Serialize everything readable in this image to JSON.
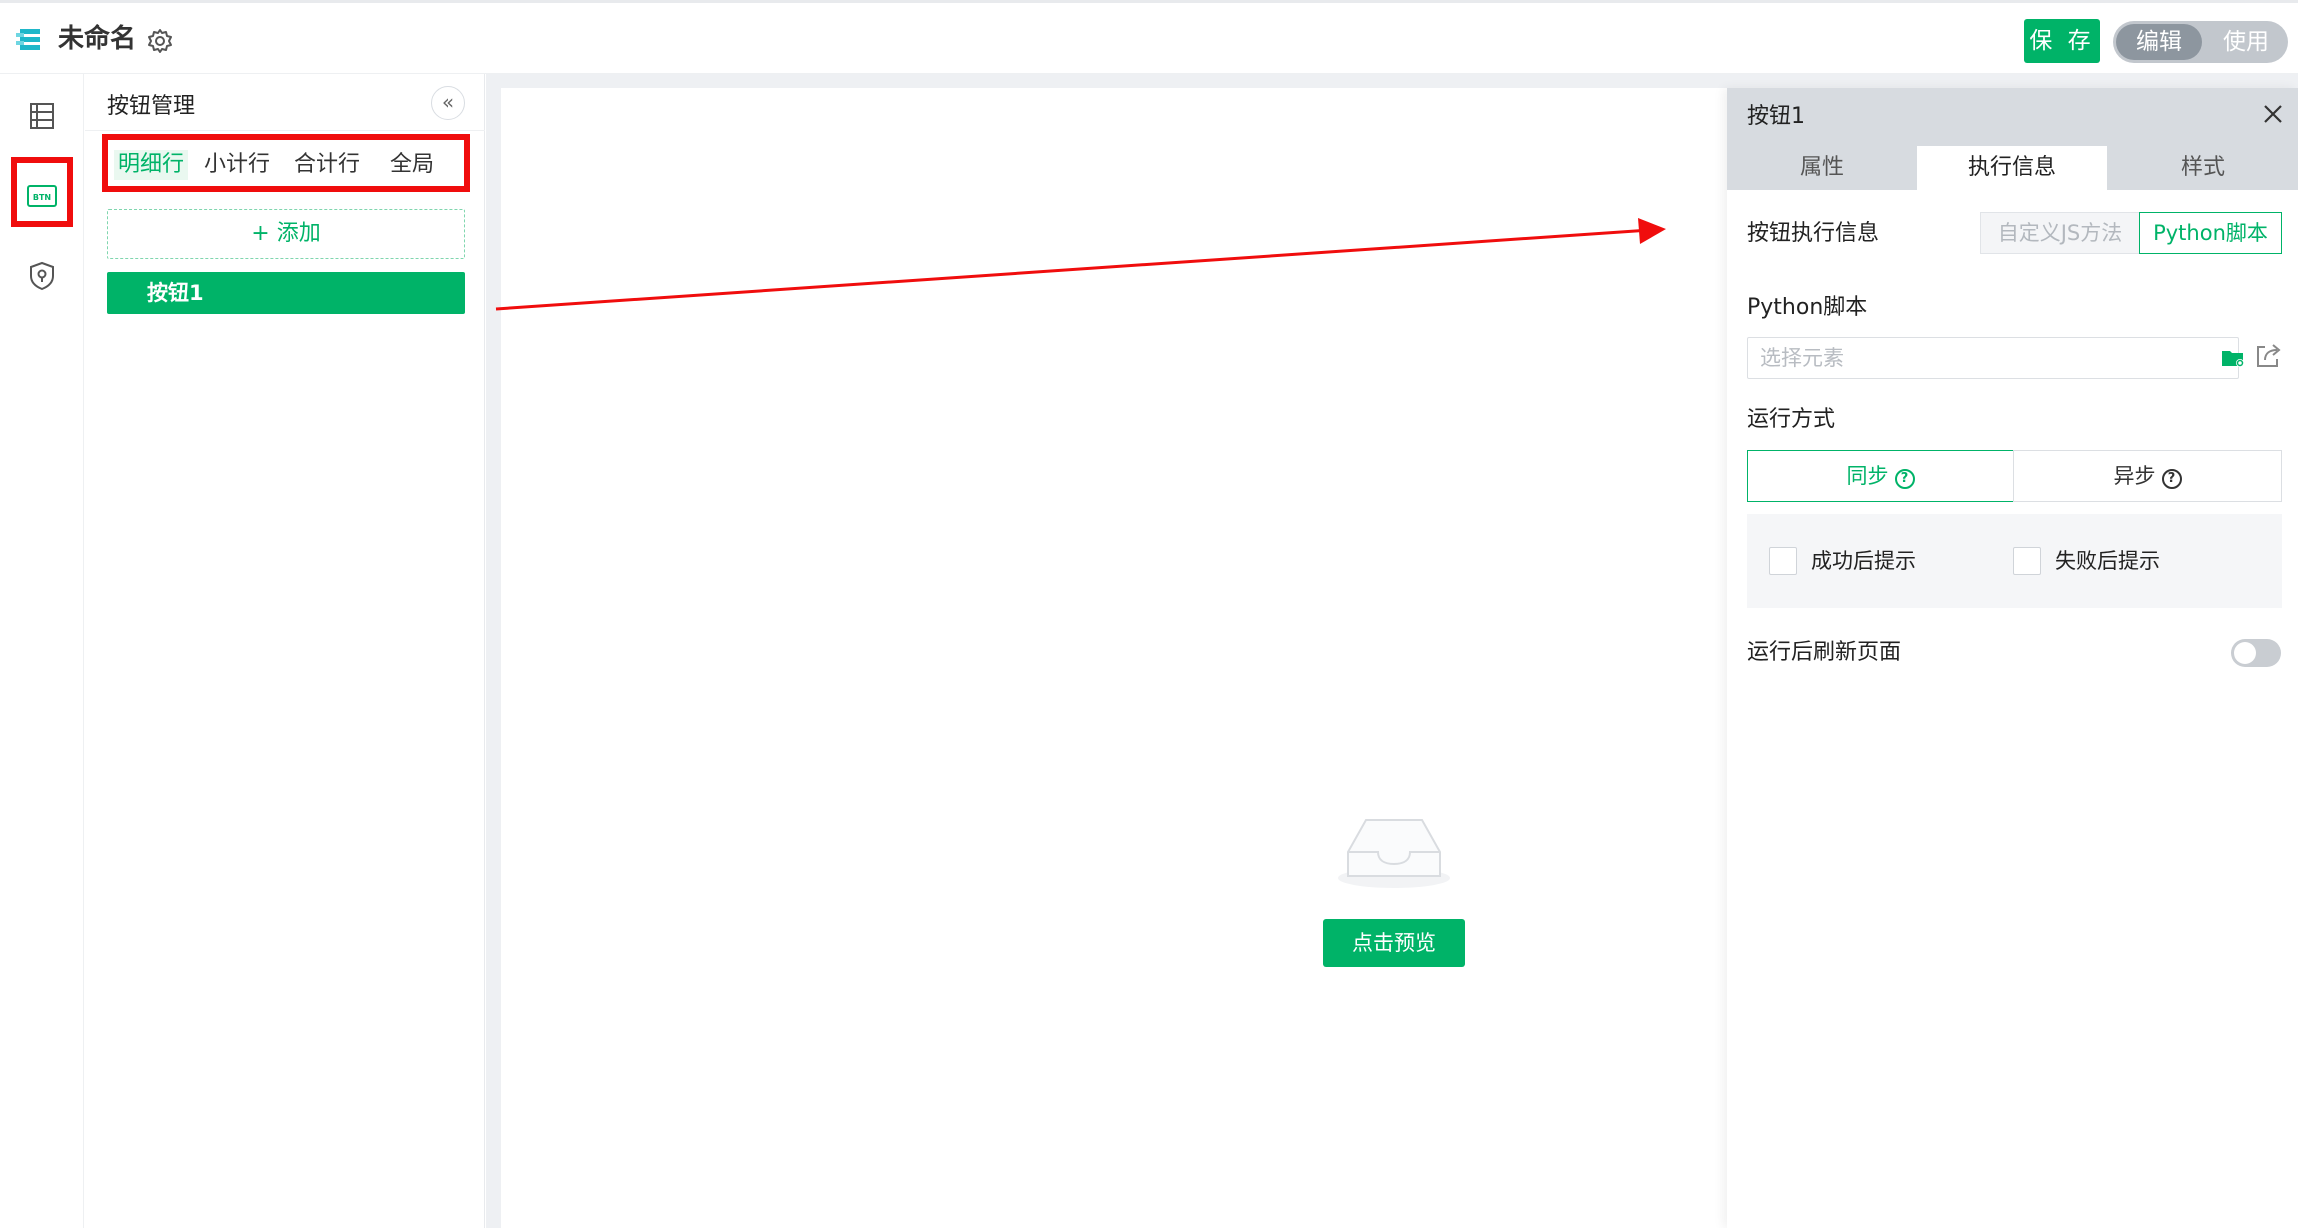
{
  "header": {
    "title": "未命名",
    "save_label": "保 存",
    "mode_edit": "编辑",
    "mode_use": "使用"
  },
  "rail": {
    "items": [
      "table-icon",
      "btn-icon",
      "shield-icon"
    ]
  },
  "button_panel": {
    "title": "按钮管理",
    "collapse_glyph": "«",
    "tabs": [
      "明细行",
      "小计行",
      "合计行",
      "全局"
    ],
    "active_tab": "明细行",
    "add_label": "+ 添加",
    "items": [
      "按钮1"
    ]
  },
  "canvas": {
    "preview_label": "点击预览"
  },
  "properties": {
    "title": "按钮1",
    "tabs": [
      "属性",
      "执行信息",
      "样式"
    ],
    "active_tab": "执行信息",
    "exec_label": "按钮执行信息",
    "exec_options": [
      "自定义JS方法",
      "Python脚本"
    ],
    "exec_selected": "Python脚本",
    "script_label": "Python脚本",
    "script_placeholder": "选择元素",
    "run_mode_label": "运行方式",
    "run_modes": [
      "同步",
      "异步"
    ],
    "run_mode_selected": "同步",
    "success_tip_label": "成功后提示",
    "fail_tip_label": "失败后提示",
    "refresh_label": "运行后刷新页面",
    "refresh_enabled": false
  },
  "colors": {
    "accent": "#00b368",
    "annotation_red": "#f00d0d"
  }
}
